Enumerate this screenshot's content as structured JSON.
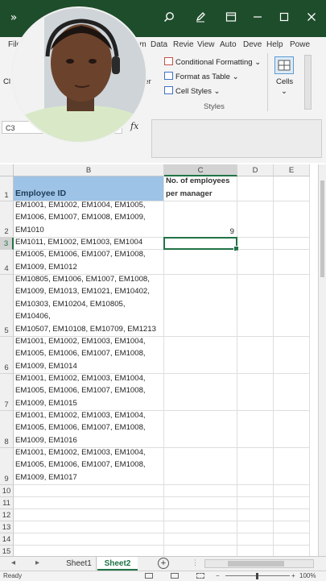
{
  "titlebar": {
    "back_icon": "chevron-icon",
    "search_icon": "search-icon",
    "pen_icon": "pen-icon",
    "minimize_icon": "minimize-icon",
    "restore_icon": "restore-icon",
    "close_icon": "close-icon"
  },
  "ribbon_tabs": [
    "File",
    "rm",
    "Data",
    "Revie",
    "View",
    "Auto",
    "Deve",
    "Help",
    "Powe"
  ],
  "ribbon": {
    "conditional_formatting": "Conditional Formatting",
    "format_as_table": "Format as Table",
    "cell_styles": "Cell Styles",
    "styles_group": "Styles",
    "cells": "Cells",
    "left_partial": "Cl",
    "num_partial": "ber"
  },
  "formula_bar": {
    "name_box": "C3",
    "fx": "fx"
  },
  "columns": [
    "B",
    "C",
    "D",
    "E"
  ],
  "rows": [
    {
      "num": "1",
      "b": "Employee ID",
      "c": "No. of employees\nper manager"
    },
    {
      "num": "2",
      "b": "EM1001, EM1002, EM1004, EM1005,\nEM1006, EM1007, EM1008, EM1009,\nEM1010",
      "c": "9"
    },
    {
      "num": "3",
      "b": "EM1011, EM1002, EM1003, EM1004",
      "c": ""
    },
    {
      "num": "4",
      "b": "EM1005, EM1006, EM1007, EM1008,\nEM1009, EM1012",
      "c": ""
    },
    {
      "num": "5",
      "b": "EM1011, EM1042, EM1063, EM1064,\nEM10805, EM1006, EM1007, EM1008,\nEM1009, EM1013, EM1021, EM10402,\nEM10303, EM10204, EM10805, EM10406,\nEM10507, EM10108, EM10709, EM1213",
      "c": ""
    },
    {
      "num": "6",
      "b": "EM1001, EM1002, EM1003, EM1004,\nEM1005, EM1006, EM1007, EM1008,\nEM1009, EM1014",
      "c": ""
    },
    {
      "num": "7",
      "b": "EM1001, EM1002, EM1003, EM1004,\nEM1005, EM1006, EM1007, EM1008,\nEM1009, EM1015",
      "c": ""
    },
    {
      "num": "8",
      "b": "EM1001, EM1002, EM1003, EM1004,\nEM1005, EM1006, EM1007, EM1008,\nEM1009, EM1016",
      "c": ""
    },
    {
      "num": "9",
      "b": "EM1001, EM1002, EM1003, EM1004,\nEM1005, EM1006, EM1007, EM1008,\nEM1009, EM1017",
      "c": ""
    },
    {
      "num": "10",
      "b": "",
      "c": ""
    },
    {
      "num": "11",
      "b": "",
      "c": ""
    },
    {
      "num": "12",
      "b": "",
      "c": ""
    },
    {
      "num": "13",
      "b": "",
      "c": ""
    },
    {
      "num": "14",
      "b": "",
      "c": ""
    },
    {
      "num": "15",
      "b": "",
      "c": ""
    }
  ],
  "sheets": {
    "sheet1": "Sheet1",
    "sheet2": "Sheet2",
    "active": "Sheet2"
  },
  "status": {
    "ready": "Ready",
    "zoom": "100%"
  },
  "colors": {
    "title_green": "#1e4d2b",
    "accent_green": "#217346",
    "header_blue": "#9dc3e6"
  }
}
